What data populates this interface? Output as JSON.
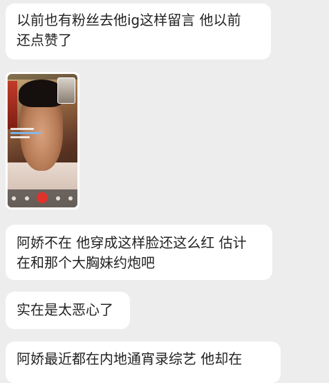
{
  "messages": [
    {
      "type": "text",
      "text": "以前也有粉丝去他ig这样留言 他以前\n还点赞了"
    },
    {
      "type": "image",
      "image": "video-call-screenshot"
    },
    {
      "type": "text",
      "text": "阿娇不在 他穿成这样脸还这么红 估计\n在和那个大胸妹约炮吧"
    },
    {
      "type": "text",
      "text": "实在是太恶心了"
    },
    {
      "type": "text",
      "text": "阿娇最近都在内地通宵录综艺 他却在"
    }
  ],
  "colors": {
    "background": "#ededed",
    "bubble": "#ffffff",
    "text": "#222222",
    "end_call": "#e0322c"
  }
}
